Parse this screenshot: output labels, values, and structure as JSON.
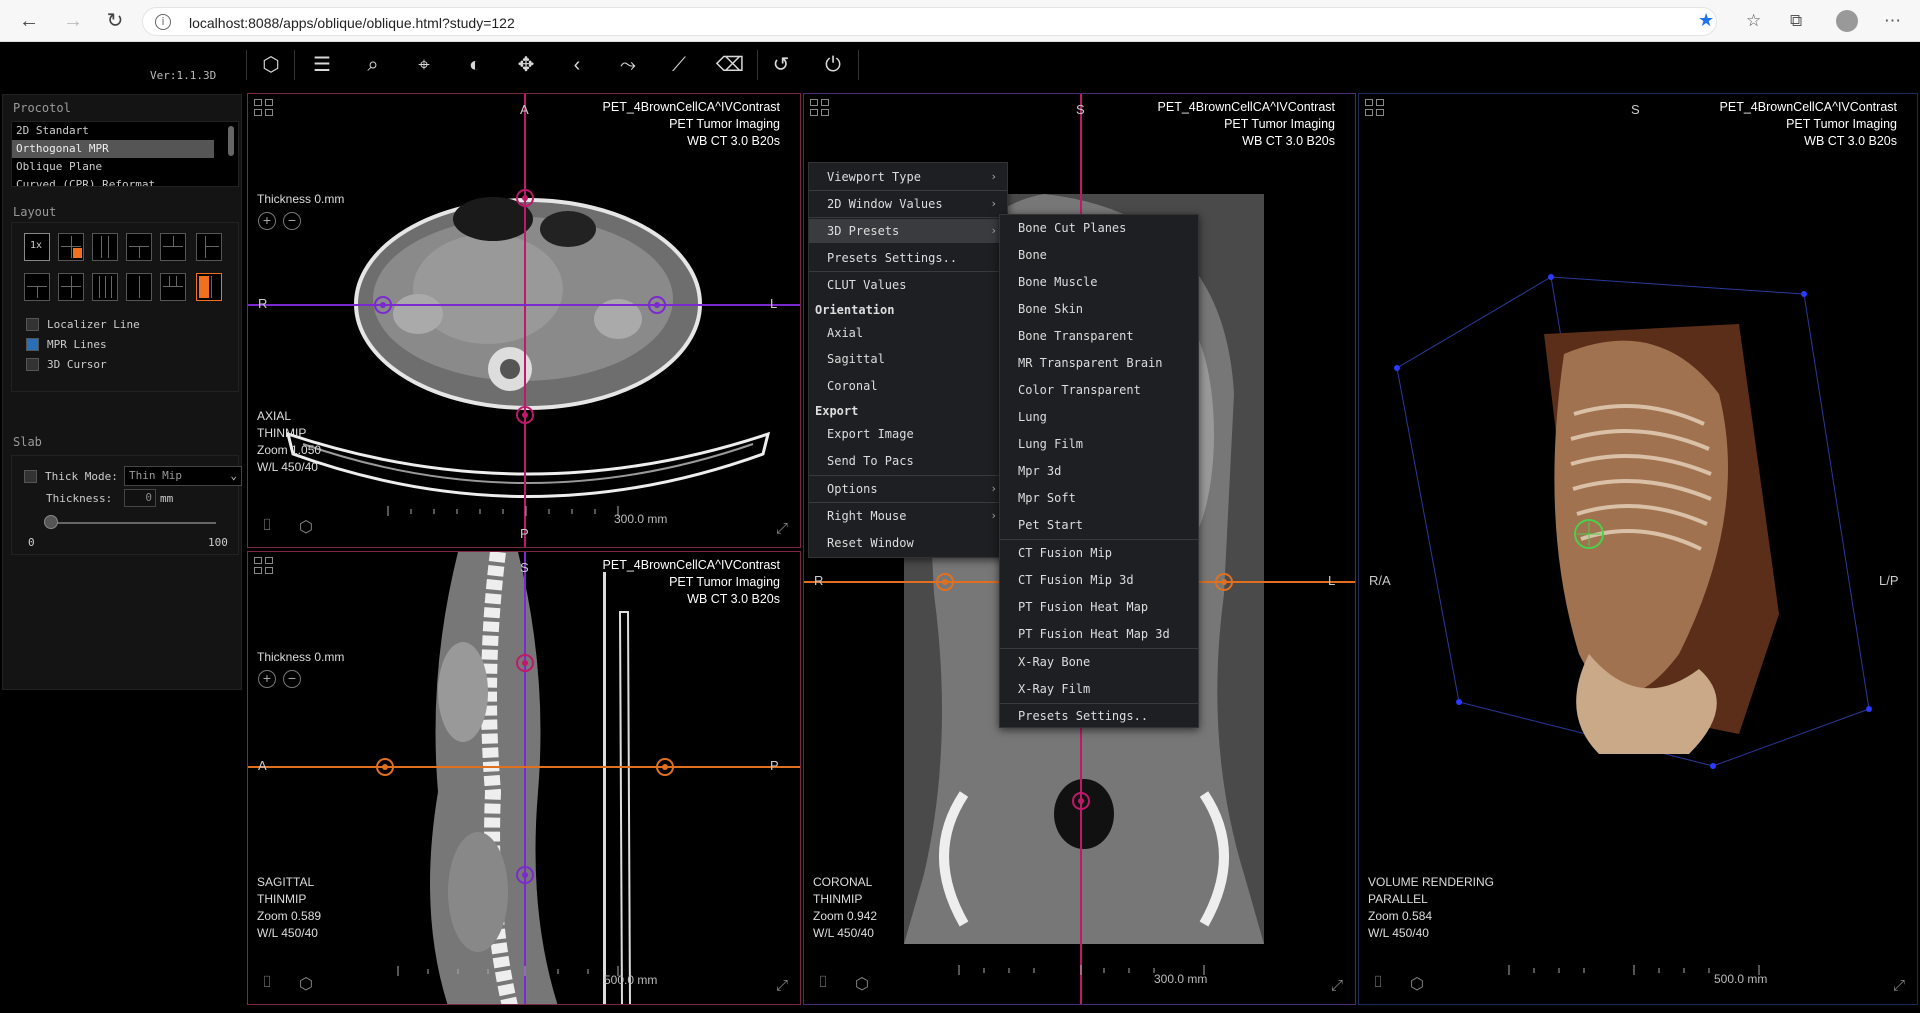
{
  "browser": {
    "url": "localhost:8088/apps/oblique/oblique.html?study=122",
    "info_icon": "info-icon"
  },
  "app": {
    "version": "Ver:1.1.3D",
    "toolbar_icons": [
      "cube-icon",
      "menu-icon",
      "zoom-icon",
      "crosshair-icon",
      "contrast-icon",
      "pan-icon",
      "back-icon",
      "curve-icon",
      "measure-icon",
      "eraser-icon",
      "reset-icon",
      "power-icon"
    ]
  },
  "sidepanel": {
    "protocol_title": "Procotol",
    "protocols": [
      "2D Standart",
      "Orthogonal MPR",
      "Oblique Plane",
      "Curved (CPR) Reformat"
    ],
    "layout_title": "Layout",
    "layout_1x": "1x",
    "localizer_line": "Localizer Line",
    "mpr_lines": "MPR Lines",
    "cursor_3d": "3D Cursor",
    "slab_title": "Slab",
    "thick_mode_label": "Thick Mode:",
    "thick_mode_value": "Thin Mip",
    "thickness_label": "Thickness:",
    "thickness_value": "0",
    "thickness_unit": "mm",
    "slider_min": "0",
    "slider_max": "100"
  },
  "viewports": {
    "axial": {
      "patient": "PET_4BrownCellCA^IVContrast",
      "study": "PET Tumor Imaging",
      "series": "WB CT  3.0  B20s",
      "thickness": "Thickness 0.mm",
      "plane": "AXIAL",
      "mode": "THINMIP",
      "zoom": "Zoom 1.050",
      "wl": "W/L 450/40",
      "top": "A",
      "bottom": "P",
      "left": "R",
      "right": "L",
      "scale": "300.0 mm"
    },
    "sagittal": {
      "patient": "PET_4BrownCellCA^IVContrast",
      "study": "PET Tumor Imaging",
      "series": "WB CT  3.0  B20s",
      "thickness": "Thickness 0.mm",
      "plane": "SAGITTAL",
      "mode": "THINMIP",
      "zoom": "Zoom 0.589",
      "wl": "W/L 450/40",
      "top": "S",
      "left": "A",
      "right": "P",
      "scale": "500.0 mm"
    },
    "coronal": {
      "patient": "PET_4BrownCellCA^IVContrast",
      "study": "PET Tumor Imaging",
      "series": "WB CT  3.0  B20s",
      "plane": "CORONAL",
      "mode": "THINMIP",
      "zoom": "Zoom 0.942",
      "wl": "W/L 450/40",
      "top": "S",
      "left": "R",
      "right": "L",
      "scale": "300.0 mm"
    },
    "volume": {
      "patient": "PET_4BrownCellCA^IVContrast",
      "study": "PET Tumor Imaging",
      "series": "WB CT  3.0  B20s",
      "plane": "VOLUME RENDERING",
      "mode": "PARALLEL",
      "zoom": "Zoom 0.584",
      "wl": "W/L 450/40",
      "top": "S",
      "left": "R/A",
      "right": "L/P",
      "scale": "500.0 mm"
    }
  },
  "context_menu": {
    "viewport_type": "Viewport Type",
    "window_values": "2D Window Values",
    "presets_3d": "3D Presets",
    "presets_settings": "Presets Settings..",
    "clut_values": "CLUT Values",
    "orientation_head": "Orientation",
    "axial": "Axial",
    "sagittal": "Sagittal",
    "coronal": "Coronal",
    "export_head": "Export",
    "export_image": "Export Image",
    "send_to_pacs": "Send To Pacs",
    "options": "Options",
    "right_mouse": "Right Mouse",
    "reset_window": "Reset Window"
  },
  "presets_menu": {
    "items": [
      "Bone Cut Planes",
      "Bone",
      "Bone Muscle",
      "Bone Skin",
      "Bone Transparent",
      "MR Transparent Brain",
      "Color Transparent",
      "Lung",
      "Lung Film",
      "Mpr 3d",
      "Mpr Soft",
      "Pet Start",
      "CT Fusion Mip",
      "CT Fusion Mip 3d",
      "PT Fusion Heat Map",
      "PT Fusion Heat Map 3d",
      "X-Ray Bone",
      "X-Ray Film",
      "Presets Settings.."
    ]
  },
  "colors": {
    "axial_line": "#c0186a",
    "sagittal_line": "#7a2acf",
    "coronal_line": "#e07020",
    "accent": "#f07020"
  }
}
